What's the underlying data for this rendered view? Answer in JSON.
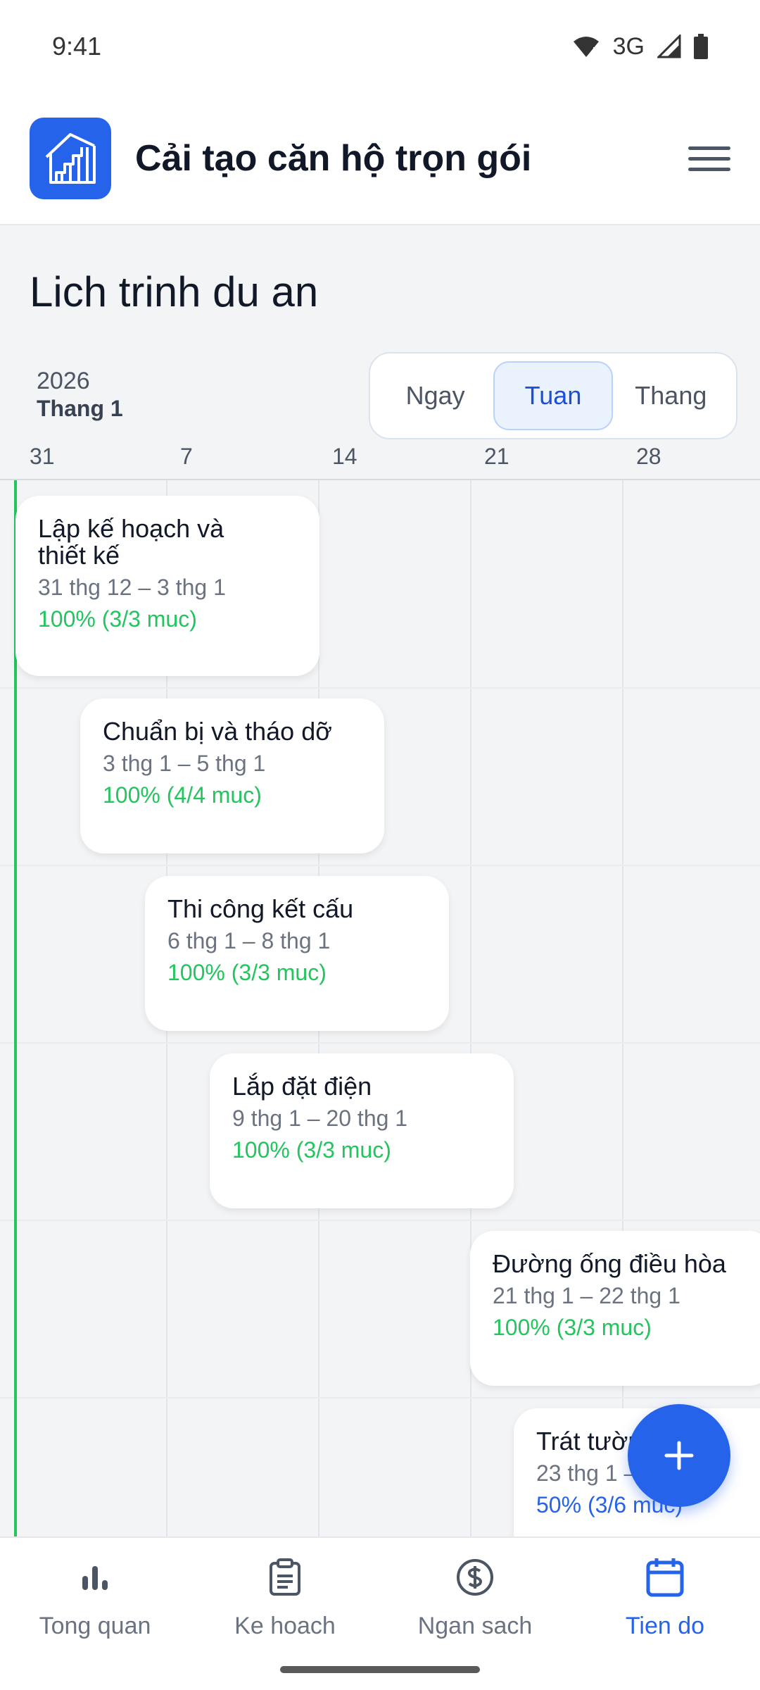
{
  "status_bar": {
    "time": "9:41",
    "network": "3G"
  },
  "app_bar": {
    "title": "Cải tạo căn hộ trọn gói",
    "logo_icon": "building-stairs-icon",
    "menu_icon": "hamburger-menu-icon"
  },
  "page": {
    "title": "Lich trinh du an"
  },
  "period": {
    "year": "2026",
    "month": "Thang 1"
  },
  "view_modes": [
    {
      "label": "Ngay",
      "selected": false
    },
    {
      "label": "Tuan",
      "selected": true
    },
    {
      "label": "Thang",
      "selected": false
    }
  ],
  "weeks": [
    "31",
    "7",
    "14",
    "21",
    "28"
  ],
  "tasks": [
    {
      "name": "Lập kế hoạch và thiết kế",
      "dates": "31 thg 12 – 3 thg 1",
      "progress": "100% (3/3 muc)",
      "percent": 100
    },
    {
      "name": "Chuẩn bị và tháo dỡ",
      "dates": "3 thg 1 – 5 thg 1",
      "progress": "100% (4/4 muc)",
      "percent": 100
    },
    {
      "name": "Thi công kết cấu",
      "dates": "6 thg 1 – 8 thg 1",
      "progress": "100% (3/3 muc)",
      "percent": 100
    },
    {
      "name": "Lắp đặt điện",
      "dates": "9 thg 1 – 20 thg 1",
      "progress": "100% (3/3 muc)",
      "percent": 100
    },
    {
      "name": "Đường ống điều hòa",
      "dates": "21 thg 1 – 22 thg 1",
      "progress": "100% (3/3 muc)",
      "percent": 100
    },
    {
      "name": "Trát tường",
      "dates": "23 thg 1 – 2",
      "progress": "50% (3/6 muc)",
      "percent": 50
    }
  ],
  "fab": {
    "icon": "plus-icon"
  },
  "bottom_nav": [
    {
      "label": "Tong quan",
      "icon": "bar-chart-icon",
      "active": false
    },
    {
      "label": "Ke hoach",
      "icon": "clipboard-icon",
      "active": false
    },
    {
      "label": "Ngan sach",
      "icon": "dollar-circle-icon",
      "active": false
    },
    {
      "label": "Tien do",
      "icon": "calendar-icon",
      "active": true
    }
  ],
  "colors": {
    "primary": "#2563eb",
    "success": "#22c55e",
    "background": "#f3f4f6"
  }
}
